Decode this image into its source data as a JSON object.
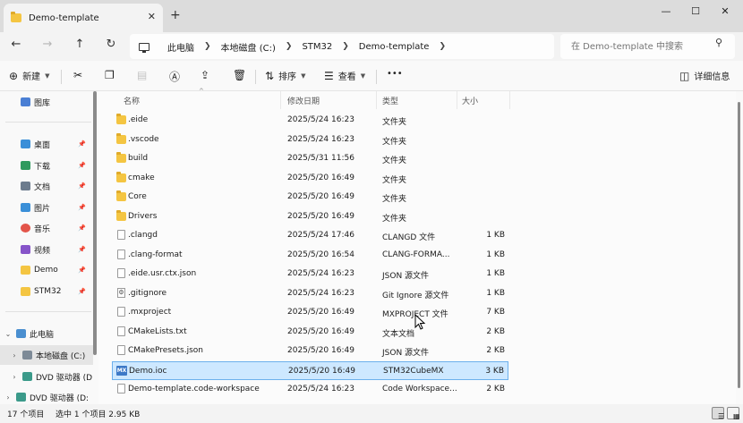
{
  "window": {
    "tab_title": "Demo-template",
    "tab_close": "✕",
    "new_tab": "+",
    "minimize": "—",
    "maximize": "☐",
    "close": "✕"
  },
  "nav": {
    "back": "←",
    "forward": "→",
    "up": "↑",
    "refresh": "↻",
    "breadcrumbs": [
      "此电脑",
      "本地磁盘 (C:)",
      "STM32",
      "Demo-template"
    ],
    "search_placeholder": "在 Demo-template 中搜索"
  },
  "commands": {
    "new": "新建",
    "sort": "排序",
    "view": "查看",
    "more": "•••",
    "details": "详细信息"
  },
  "sidebar": {
    "items": [
      {
        "label": "图库",
        "icon": "gallery-icon",
        "color": "#4a7fd4",
        "pinned": false
      },
      {
        "label": "桌面",
        "icon": "desktop-icon",
        "color": "#3a8fd8",
        "pinned": true
      },
      {
        "label": "下载",
        "icon": "download-icon",
        "color": "#2f9a5e",
        "pinned": true
      },
      {
        "label": "文档",
        "icon": "documents-icon",
        "color": "#6d7c8e",
        "pinned": true
      },
      {
        "label": "图片",
        "icon": "pictures-icon",
        "color": "#3a8fd8",
        "pinned": true
      },
      {
        "label": "音乐",
        "icon": "music-icon",
        "color": "#e3554a",
        "pinned": true
      },
      {
        "label": "视频",
        "icon": "videos-icon",
        "color": "#8654c9",
        "pinned": true
      },
      {
        "label": "Demo",
        "icon": "folder-icon",
        "color": "#f4c542",
        "pinned": true
      },
      {
        "label": "STM32",
        "icon": "folder-icon",
        "color": "#f4c542",
        "pinned": true
      }
    ],
    "this_pc": "此电脑",
    "local_disk": "本地磁盘 (C:)",
    "dvd1": "DVD 驱动器 (D",
    "dvd2": "DVD 驱动器 (D:"
  },
  "columns": {
    "name": "名称",
    "modified": "修改日期",
    "type": "类型",
    "size": "大小"
  },
  "files": [
    {
      "name": ".eide",
      "date": "2025/5/24 16:23",
      "type": "文件夹",
      "size": "",
      "icon": "folder"
    },
    {
      "name": ".vscode",
      "date": "2025/5/24 16:23",
      "type": "文件夹",
      "size": "",
      "icon": "folder"
    },
    {
      "name": "build",
      "date": "2025/5/31 11:56",
      "type": "文件夹",
      "size": "",
      "icon": "folder"
    },
    {
      "name": "cmake",
      "date": "2025/5/20 16:49",
      "type": "文件夹",
      "size": "",
      "icon": "folder"
    },
    {
      "name": "Core",
      "date": "2025/5/20 16:49",
      "type": "文件夹",
      "size": "",
      "icon": "folder"
    },
    {
      "name": "Drivers",
      "date": "2025/5/20 16:49",
      "type": "文件夹",
      "size": "",
      "icon": "folder"
    },
    {
      "name": ".clangd",
      "date": "2025/5/24 17:46",
      "type": "CLANGD 文件",
      "size": "1 KB",
      "icon": "doc"
    },
    {
      "name": ".clang-format",
      "date": "2025/5/20 16:54",
      "type": "CLANG-FORMA...",
      "size": "1 KB",
      "icon": "doc"
    },
    {
      "name": ".eide.usr.ctx.json",
      "date": "2025/5/24 16:23",
      "type": "JSON 源文件",
      "size": "1 KB",
      "icon": "doc"
    },
    {
      "name": ".gitignore",
      "date": "2025/5/24 16:23",
      "type": "Git Ignore 源文件",
      "size": "1 KB",
      "icon": "gear"
    },
    {
      "name": ".mxproject",
      "date": "2025/5/20 16:49",
      "type": "MXPROJECT 文件",
      "size": "7 KB",
      "icon": "doc"
    },
    {
      "name": "CMakeLists.txt",
      "date": "2025/5/20 16:49",
      "type": "文本文档",
      "size": "2 KB",
      "icon": "doc"
    },
    {
      "name": "CMakePresets.json",
      "date": "2025/5/20 16:49",
      "type": "JSON 源文件",
      "size": "2 KB",
      "icon": "doc"
    },
    {
      "name": "Demo.ioc",
      "date": "2025/5/20 16:49",
      "type": "STM32CubeMX",
      "size": "3 KB",
      "icon": "mx",
      "selected": true
    },
    {
      "name": "Demo-template.code-workspace",
      "date": "2025/5/24 16:23",
      "type": "Code Workspace...",
      "size": "2 KB",
      "icon": "doc"
    }
  ],
  "mx_badge": "MX",
  "status": {
    "count": "17 个项目",
    "selected": "选中 1 个项目  2.95 KB"
  }
}
